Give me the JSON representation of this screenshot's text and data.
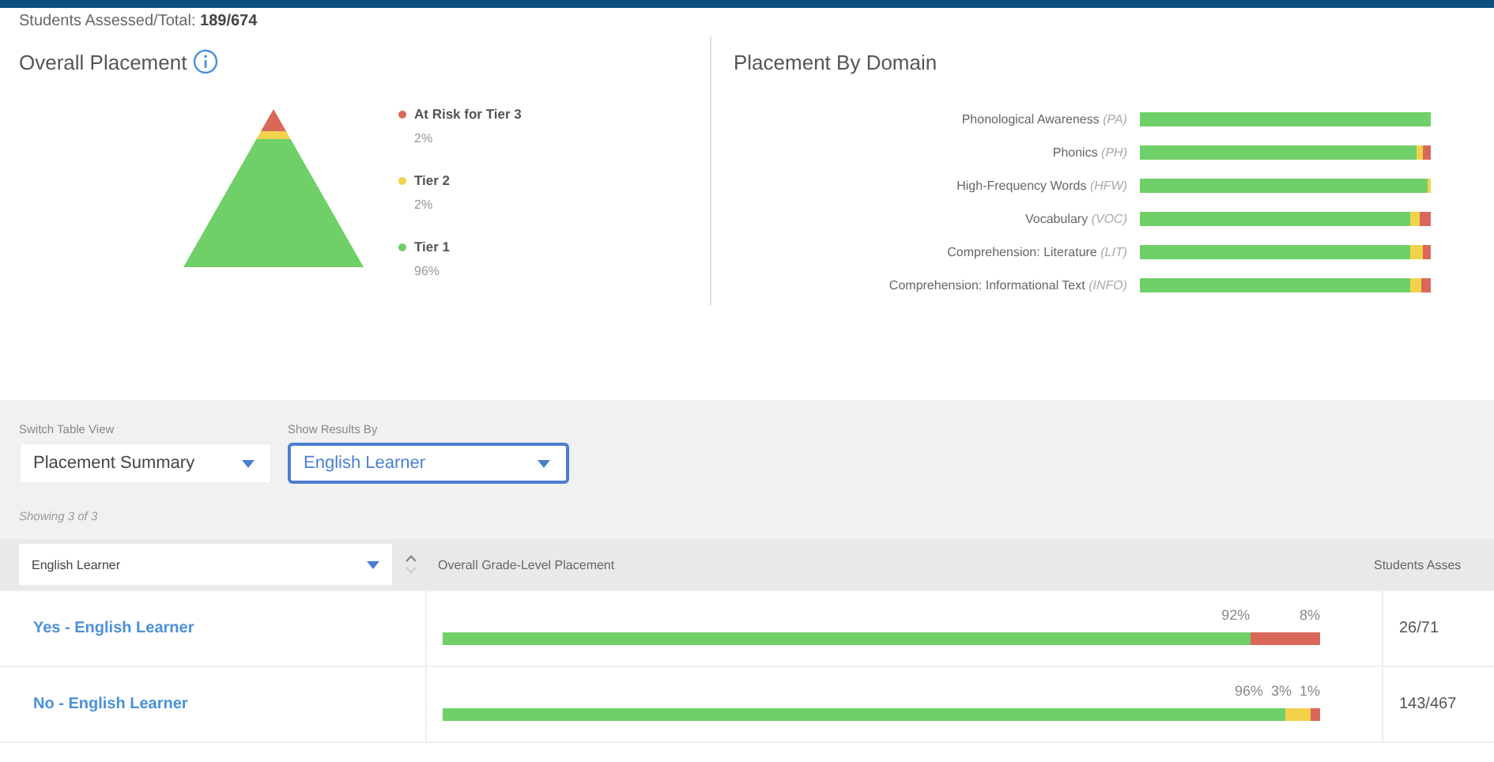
{
  "summary": {
    "label": "Students Assessed/Total:",
    "value": "189/674"
  },
  "overall": {
    "title": "Overall Placement",
    "tiers": [
      {
        "name": "At Risk for Tier 3",
        "percent": "2%",
        "color": "#d9685a"
      },
      {
        "name": "Tier 2",
        "percent": "2%",
        "color": "#f2d24b"
      },
      {
        "name": "Tier 1",
        "percent": "96%",
        "color": "#6fcf68"
      }
    ]
  },
  "domain": {
    "title": "Placement By Domain",
    "rows": [
      {
        "name": "Phonological Awareness",
        "abbr": "(PA)",
        "segments": [
          {
            "color": "#6fcf68",
            "level": 1
          }
        ]
      },
      {
        "name": "Phonics",
        "abbr": "(PH)",
        "segments": [
          {
            "color": "#6fcf68",
            "level": 0.95
          },
          {
            "color": "#f2d24b",
            "level": 0.025
          },
          {
            "color": "#d9685a",
            "level": 0.025
          }
        ]
      },
      {
        "name": "High-Frequency Words",
        "abbr": "(HFW)",
        "segments": [
          {
            "color": "#6fcf68",
            "level": 0.99
          },
          {
            "color": "#f2d24b",
            "level": 0.01
          }
        ]
      },
      {
        "name": "Vocabulary",
        "abbr": "(VOC)",
        "segments": [
          {
            "color": "#6fcf68",
            "level": 0.93
          },
          {
            "color": "#f2d24b",
            "level": 0.03
          },
          {
            "color": "#d9685a",
            "level": 0.04
          }
        ]
      },
      {
        "name": "Comprehension: Literature",
        "abbr": "(LIT)",
        "segments": [
          {
            "color": "#6fcf68",
            "level": 0.93
          },
          {
            "color": "#f2d24b",
            "level": 0.045
          },
          {
            "color": "#d9685a",
            "level": 0.025
          }
        ]
      },
      {
        "name": "Comprehension: Informational Text",
        "abbr": "(INFO)",
        "segments": [
          {
            "color": "#6fcf68",
            "level": 0.93
          },
          {
            "color": "#f2d24b"
          },
          {
            "color": "#d9685a",
            "level": 0.035
          }
        ]
      }
    ]
  },
  "controls": [
    {
      "label": "Switch Table View",
      "value": "Placement Summary",
      "focused": false
    },
    {
      "label": "Show Results By",
      "value": "English Learner",
      "focused": true
    }
  ],
  "showing": "Showing 3 of 3",
  "table": {
    "filter": "English Learner",
    "columns": [
      "Overall Grade-Level Placement",
      "Students Asses"
    ],
    "rows": [
      {
        "name": "Yes - English Learner",
        "assessed": "26/71",
        "segments": [
          {
            "label": "92%",
            "level": 0.92,
            "color": "#6fcf68"
          },
          {
            "label": "8%",
            "level": 0.08,
            "color": "#d9685a"
          }
        ]
      },
      {
        "name": "No - English Learner",
        "assessed": "143/467",
        "segments": [
          {
            "label": "96%",
            "level": 0.96,
            "color": "#6fcf68"
          },
          {
            "label": "3%",
            "level": 0.03,
            "color": "#f2d24b"
          },
          {
            "label": "1%",
            "level": 0.01,
            "color": "#d9685a"
          }
        ]
      }
    ]
  }
}
